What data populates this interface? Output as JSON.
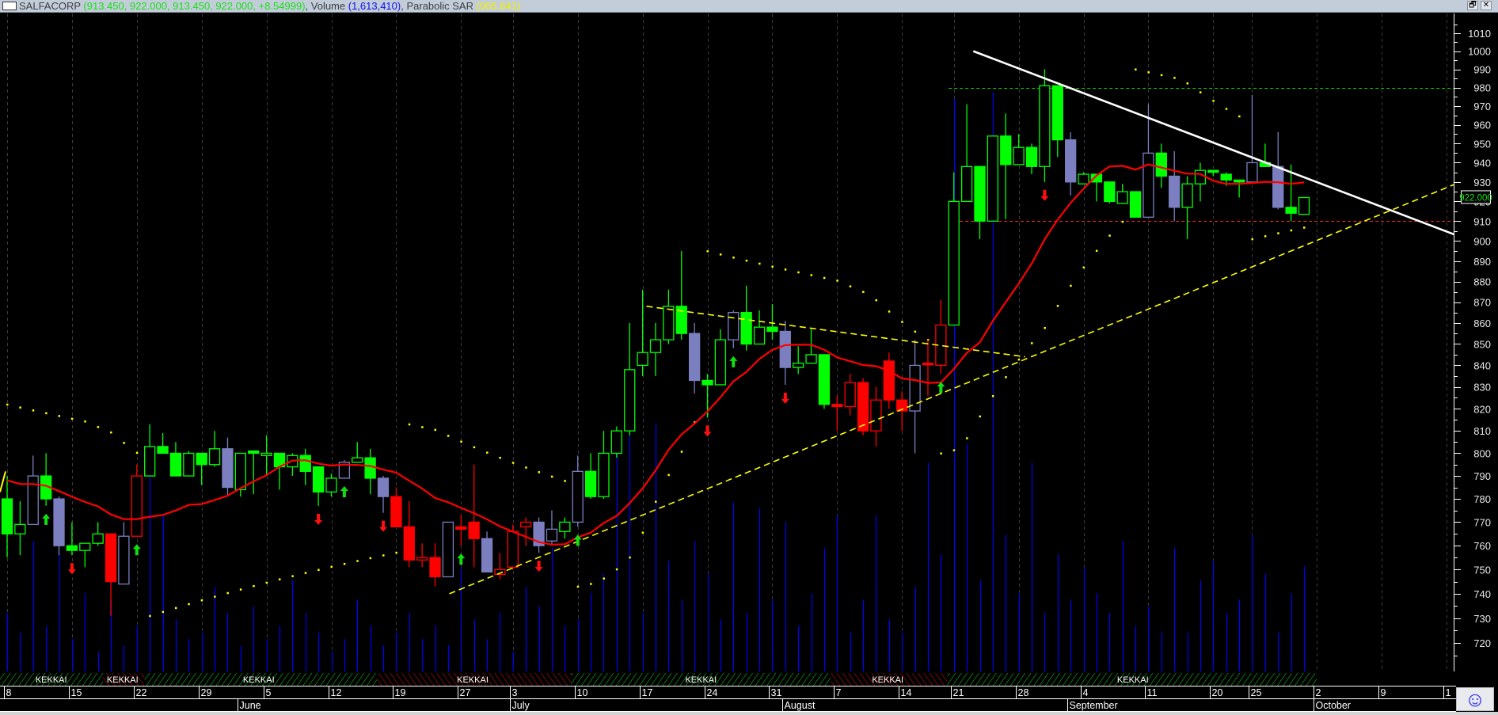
{
  "title": {
    "symbol": "SALFACORP",
    "ohlc": "(913.450, 922.000, 913.450, 922.000, +8.54999)",
    "volume_label": ", Volume ",
    "volume_value": "(1,613,410)",
    "sar_label": ", Parabolic SAR ",
    "sar_value": "(905.841)"
  },
  "window_buttons": {
    "restore": "🗗",
    "close": "✕"
  },
  "last_price_tag": "922.000",
  "smiley_button": "☺",
  "colors": {
    "up": "#00ff00",
    "down": "#ff0000",
    "neutral": "#7b7fc0",
    "volume": "#0000ff",
    "sar": "#ffff00",
    "ma": "#ff0000",
    "trend_white": "#ffffff",
    "trend_yellow": "#ffff00",
    "resistance": "#00dd00",
    "support": "#ff2020"
  },
  "chart_data": {
    "type": "candlestick",
    "title": "SALFACORP",
    "y_scale": "log",
    "ylim": [
      706,
      1016
    ],
    "y_ticks": [
      "720",
      "730",
      "740",
      "750",
      "760",
      "770",
      "780",
      "790",
      "800",
      "810",
      "820",
      "830",
      "840",
      "850",
      "860",
      "870",
      "880",
      "890",
      "900",
      "910",
      "920",
      "930",
      "940",
      "950",
      "960",
      "970",
      "980",
      "990",
      "1000",
      "1010"
    ],
    "bars_ohlc_color": [
      [
        780,
        790,
        755,
        765,
        "g"
      ],
      [
        765,
        779,
        756,
        769,
        "g"
      ],
      [
        769,
        799,
        769,
        790,
        "p"
      ],
      [
        790,
        800,
        777,
        780,
        "g"
      ],
      [
        780,
        781,
        756,
        760,
        "p"
      ],
      [
        760,
        770,
        756,
        758,
        "g"
      ],
      [
        758,
        761,
        751,
        761,
        "g"
      ],
      [
        761,
        770,
        760,
        765,
        "g"
      ],
      [
        765,
        765,
        731,
        745,
        "r"
      ],
      [
        744,
        770,
        744,
        764,
        "p"
      ],
      [
        764,
        795,
        764,
        790,
        "r"
      ],
      [
        790,
        813,
        790,
        803,
        "g"
      ],
      [
        803,
        809,
        800,
        800,
        "g"
      ],
      [
        800,
        805,
        790,
        790,
        "g"
      ],
      [
        790,
        801,
        790,
        800,
        "g"
      ],
      [
        800,
        800,
        786,
        795,
        "g"
      ],
      [
        795,
        810,
        794,
        802,
        "g"
      ],
      [
        802,
        807,
        781,
        785,
        "p"
      ],
      [
        784,
        800,
        781,
        800,
        "g"
      ],
      [
        801,
        801,
        782,
        800,
        "g"
      ],
      [
        799,
        808,
        790,
        800,
        "g"
      ],
      [
        800,
        800,
        784,
        794,
        "g"
      ],
      [
        794,
        800,
        790,
        799,
        "g"
      ],
      [
        799,
        802,
        786,
        792,
        "g"
      ],
      [
        794,
        794,
        777,
        783,
        "g"
      ],
      [
        783,
        791,
        781,
        789,
        "g"
      ],
      [
        789,
        797,
        789,
        796,
        "p"
      ],
      [
        796,
        805,
        796,
        798,
        "g"
      ],
      [
        798,
        802,
        782,
        789,
        "g"
      ],
      [
        789,
        790,
        774,
        781,
        "p"
      ],
      [
        781,
        785,
        768,
        768,
        "r"
      ],
      [
        768,
        779,
        751,
        754,
        "r"
      ],
      [
        754,
        761,
        751,
        755,
        "r"
      ],
      [
        755,
        761,
        743,
        747,
        "r"
      ],
      [
        747,
        770,
        747,
        770,
        "p"
      ],
      [
        768,
        773,
        760,
        767,
        "r"
      ],
      [
        770,
        795,
        751,
        763,
        "r"
      ],
      [
        763,
        766,
        749,
        749,
        "p"
      ],
      [
        748,
        757,
        746,
        750,
        "r"
      ],
      [
        751,
        769,
        750,
        766,
        "r"
      ],
      [
        768,
        772,
        760,
        770,
        "r"
      ],
      [
        770,
        772,
        757,
        760,
        "p"
      ],
      [
        762,
        775,
        760,
        767,
        "p"
      ],
      [
        766,
        772,
        763,
        770,
        "g"
      ],
      [
        770,
        799,
        768,
        792,
        "p"
      ],
      [
        792,
        800,
        780,
        781,
        "g"
      ],
      [
        781,
        810,
        780,
        800,
        "g"
      ],
      [
        800,
        812,
        798,
        810,
        "g"
      ],
      [
        810,
        860,
        808,
        838,
        "g"
      ],
      [
        840,
        876,
        835,
        846,
        "g"
      ],
      [
        846,
        860,
        835,
        852,
        "g"
      ],
      [
        852,
        876,
        850,
        868,
        "g"
      ],
      [
        868,
        895,
        852,
        855,
        "g"
      ],
      [
        855,
        860,
        827,
        833,
        "p"
      ],
      [
        833,
        836,
        816,
        831,
        "g"
      ],
      [
        831,
        857,
        831,
        852,
        "g"
      ],
      [
        852,
        866,
        848,
        865,
        "p"
      ],
      [
        865,
        878,
        847,
        850,
        "g"
      ],
      [
        850,
        866,
        850,
        858,
        "g"
      ],
      [
        858,
        869,
        852,
        856,
        "g"
      ],
      [
        856,
        861,
        831,
        839,
        "p"
      ],
      [
        839,
        849,
        836,
        841,
        "g"
      ],
      [
        841,
        857,
        841,
        845,
        "g"
      ],
      [
        845,
        845,
        820,
        822,
        "g"
      ],
      [
        822,
        826,
        810,
        821,
        "r"
      ],
      [
        821,
        836,
        817,
        832,
        "r"
      ],
      [
        832,
        834,
        808,
        810,
        "r"
      ],
      [
        810,
        830,
        803,
        824,
        "r"
      ],
      [
        842,
        846,
        820,
        824,
        "r"
      ],
      [
        824,
        828,
        810,
        819,
        "r"
      ],
      [
        819,
        852,
        800,
        840,
        "p"
      ],
      [
        841,
        852,
        826,
        841,
        "r"
      ],
      [
        840,
        871,
        836,
        859,
        "r"
      ],
      [
        859,
        935,
        859,
        920,
        "g"
      ],
      [
        920,
        971,
        920,
        938,
        "g"
      ],
      [
        938,
        938,
        901,
        910,
        "g"
      ],
      [
        910,
        954,
        910,
        954,
        "g"
      ],
      [
        954,
        966,
        911,
        939,
        "g"
      ],
      [
        939,
        955,
        939,
        948,
        "g"
      ],
      [
        948,
        950,
        934,
        938,
        "g"
      ],
      [
        938,
        990,
        930,
        981,
        "g"
      ],
      [
        981,
        981,
        943,
        952,
        "g"
      ],
      [
        952,
        956,
        923,
        930,
        "p"
      ],
      [
        929,
        935,
        929,
        934,
        "g"
      ],
      [
        934,
        934,
        920,
        930,
        "g"
      ],
      [
        930,
        930,
        919,
        920,
        "g"
      ],
      [
        919,
        929,
        919,
        925,
        "g"
      ],
      [
        925,
        925,
        912,
        912,
        "g"
      ],
      [
        912,
        971,
        912,
        945,
        "p"
      ],
      [
        945,
        950,
        927,
        933,
        "g"
      ],
      [
        933,
        946,
        910,
        917,
        "p"
      ],
      [
        917,
        933,
        901,
        929,
        "g"
      ],
      [
        929,
        940,
        920,
        936,
        "g"
      ],
      [
        936,
        936,
        933,
        935,
        "g"
      ],
      [
        934,
        935,
        928,
        931,
        "g"
      ],
      [
        931,
        931,
        922,
        930,
        "g"
      ],
      [
        930,
        976,
        930,
        940,
        "p"
      ],
      [
        940,
        950,
        938,
        938,
        "g"
      ],
      [
        938,
        956,
        916,
        917,
        "p"
      ],
      [
        917,
        939,
        910,
        914,
        "g"
      ],
      [
        913.45,
        922,
        913.45,
        922,
        "g"
      ]
    ],
    "volume_thousands": [
      900,
      600,
      2000,
      700,
      1800,
      500,
      1200,
      300,
      1100,
      400,
      700,
      3400,
      2400,
      800,
      500,
      600,
      1300,
      900,
      400,
      1000,
      500,
      700,
      1400,
      900,
      600,
      300,
      500,
      1100,
      700,
      400,
      600,
      900,
      500,
      700,
      400,
      1600,
      800,
      500,
      900,
      300,
      1300,
      1000,
      1900,
      700,
      800,
      1200,
      1500,
      3500,
      4100,
      900,
      3800,
      1700,
      1100,
      2000,
      1500,
      800,
      2600,
      900,
      2500,
      1100,
      2300,
      700,
      1200,
      1900,
      2400,
      600,
      1100,
      2400,
      800,
      600,
      1300,
      3200,
      1800,
      8800,
      3500,
      1400,
      8900,
      2100,
      1200,
      3200,
      900,
      1800,
      1100,
      1600,
      1200,
      900,
      2000,
      700,
      1000,
      600,
      1900,
      600,
      1400,
      1700,
      900,
      1100,
      2100,
      1500,
      600,
      1200,
      1613
    ],
    "volume_max_thousands": 9000,
    "moving_average_period": 13,
    "parabolic_sar": {
      "step": 0.02,
      "max": 0.2,
      "initial": 822,
      "initial_trend": "down"
    },
    "signal_arrows": {
      "up": [
        3,
        10,
        26,
        35,
        44,
        56,
        72
      ],
      "down": [
        5,
        24,
        29,
        41,
        54,
        60,
        80
      ]
    },
    "horizontal_levels": [
      {
        "name": "resistance-line",
        "price": 980,
        "from_bar": 72.6,
        "color": "#00dd00"
      },
      {
        "name": "support-line",
        "price": 910,
        "from_bar": 72.6,
        "color": "#ff2020"
      }
    ],
    "trend_lines": [
      {
        "name": "white-downtrend-line",
        "from": [
          74.5,
          1000
        ],
        "to": [
          111.7,
          903
        ],
        "color": "#ffffff",
        "dashed": false
      },
      {
        "name": "yellow-upper-wedge-line",
        "from": [
          49.3,
          868
        ],
        "to": [
          78.5,
          844
        ],
        "color": "#ffff00",
        "dashed": true
      },
      {
        "name": "yellow-uptrend-line",
        "from": [
          34.1,
          740
        ],
        "to": [
          111.7,
          929
        ],
        "color": "#ffff00",
        "dashed": true
      }
    ],
    "date_ticks": [
      {
        "bar": 0,
        "label": "8"
      },
      {
        "bar": 5,
        "label": "15"
      },
      {
        "bar": 10,
        "label": "22"
      },
      {
        "bar": 15,
        "label": "29"
      },
      {
        "bar": 20,
        "label": "5"
      },
      {
        "bar": 25,
        "label": "12"
      },
      {
        "bar": 30,
        "label": "19"
      },
      {
        "bar": 35,
        "label": "27"
      },
      {
        "bar": 39,
        "label": "3"
      },
      {
        "bar": 44,
        "label": "10"
      },
      {
        "bar": 49,
        "label": "17"
      },
      {
        "bar": 54,
        "label": "24"
      },
      {
        "bar": 59,
        "label": "31"
      },
      {
        "bar": 64,
        "label": "7"
      },
      {
        "bar": 69,
        "label": "14"
      },
      {
        "bar": 73,
        "label": "21"
      },
      {
        "bar": 78,
        "label": "28"
      },
      {
        "bar": 83,
        "label": "4"
      },
      {
        "bar": 88,
        "label": "11"
      },
      {
        "bar": 93,
        "label": "20"
      },
      {
        "bar": 96,
        "label": "25"
      },
      {
        "bar": 101,
        "label": "2"
      },
      {
        "bar": 106,
        "label": "9"
      },
      {
        "bar": 111,
        "label": "1"
      }
    ],
    "month_ticks": [
      {
        "bar": 18,
        "label": "June"
      },
      {
        "bar": 39,
        "label": "July"
      },
      {
        "bar": 60,
        "label": "August"
      },
      {
        "bar": 82,
        "label": "September"
      },
      {
        "bar": 101,
        "label": "October"
      }
    ],
    "signal_band": [
      {
        "from": -0.6,
        "to": 7.4,
        "color": "green",
        "label": "KEKKAI",
        "label_at": 3.4
      },
      {
        "from": 7.4,
        "to": 10.6,
        "color": "red",
        "label": "KEKKAI",
        "label_at": 8.9
      },
      {
        "from": 10.6,
        "to": 28.5,
        "color": "green",
        "label": "KEKKAI",
        "label_at": 19.4
      },
      {
        "from": 28.5,
        "to": 43.5,
        "color": "red",
        "label": "KEKKAI",
        "label_at": 35.9
      },
      {
        "from": 43.5,
        "to": 63.5,
        "color": "green",
        "label": "KEKKAI",
        "label_at": 53.5
      },
      {
        "from": 63.5,
        "to": 72.5,
        "color": "red",
        "label": "KEKKAI",
        "label_at": 67.9
      },
      {
        "from": 72.5,
        "to": 101,
        "color": "green",
        "label": "KEKKAI",
        "label_at": 86.8
      }
    ]
  }
}
